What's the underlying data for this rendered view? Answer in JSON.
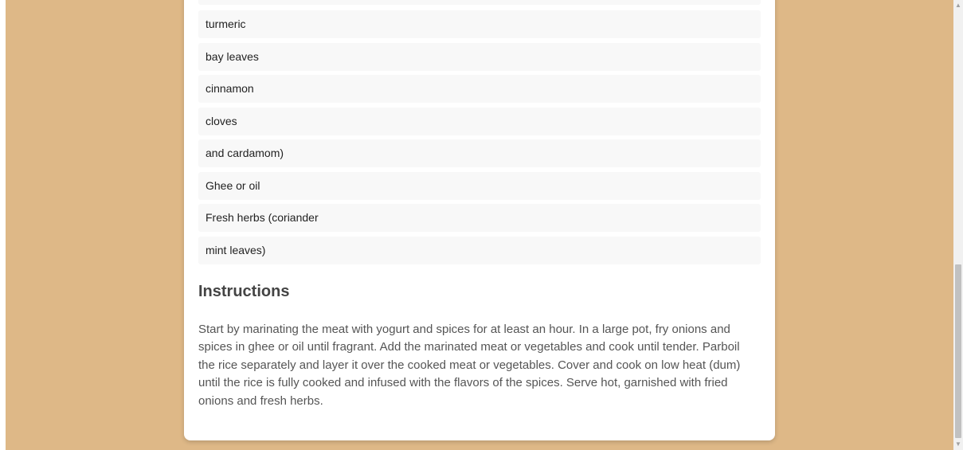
{
  "recipe": {
    "ingredients": [
      "",
      "turmeric",
      "bay leaves",
      "cinnamon",
      "cloves",
      "and cardamom)",
      "Ghee or oil",
      "Fresh herbs (coriander",
      "mint leaves)"
    ],
    "instructions_title": "Instructions",
    "instructions_text": "Start by marinating the meat with yogurt and spices for at least an hour. In a large pot, fry onions and spices in ghee or oil until fragrant. Add the marinated meat or vegetables and cook until tender. Parboil the rice separately and layer it over the cooked meat or vegetables. Cover and cook on low heat (dum) until the rice is fully cooked and infused with the flavors of the spices. Serve hot, garnished with fried onions and fresh herbs."
  },
  "scrollbar": {
    "up_icon": "chevron-up-icon",
    "down_icon": "chevron-down-icon"
  },
  "colors": {
    "page_background": "#deb887",
    "card_background": "#ffffff",
    "item_background": "#f8f8f8"
  }
}
